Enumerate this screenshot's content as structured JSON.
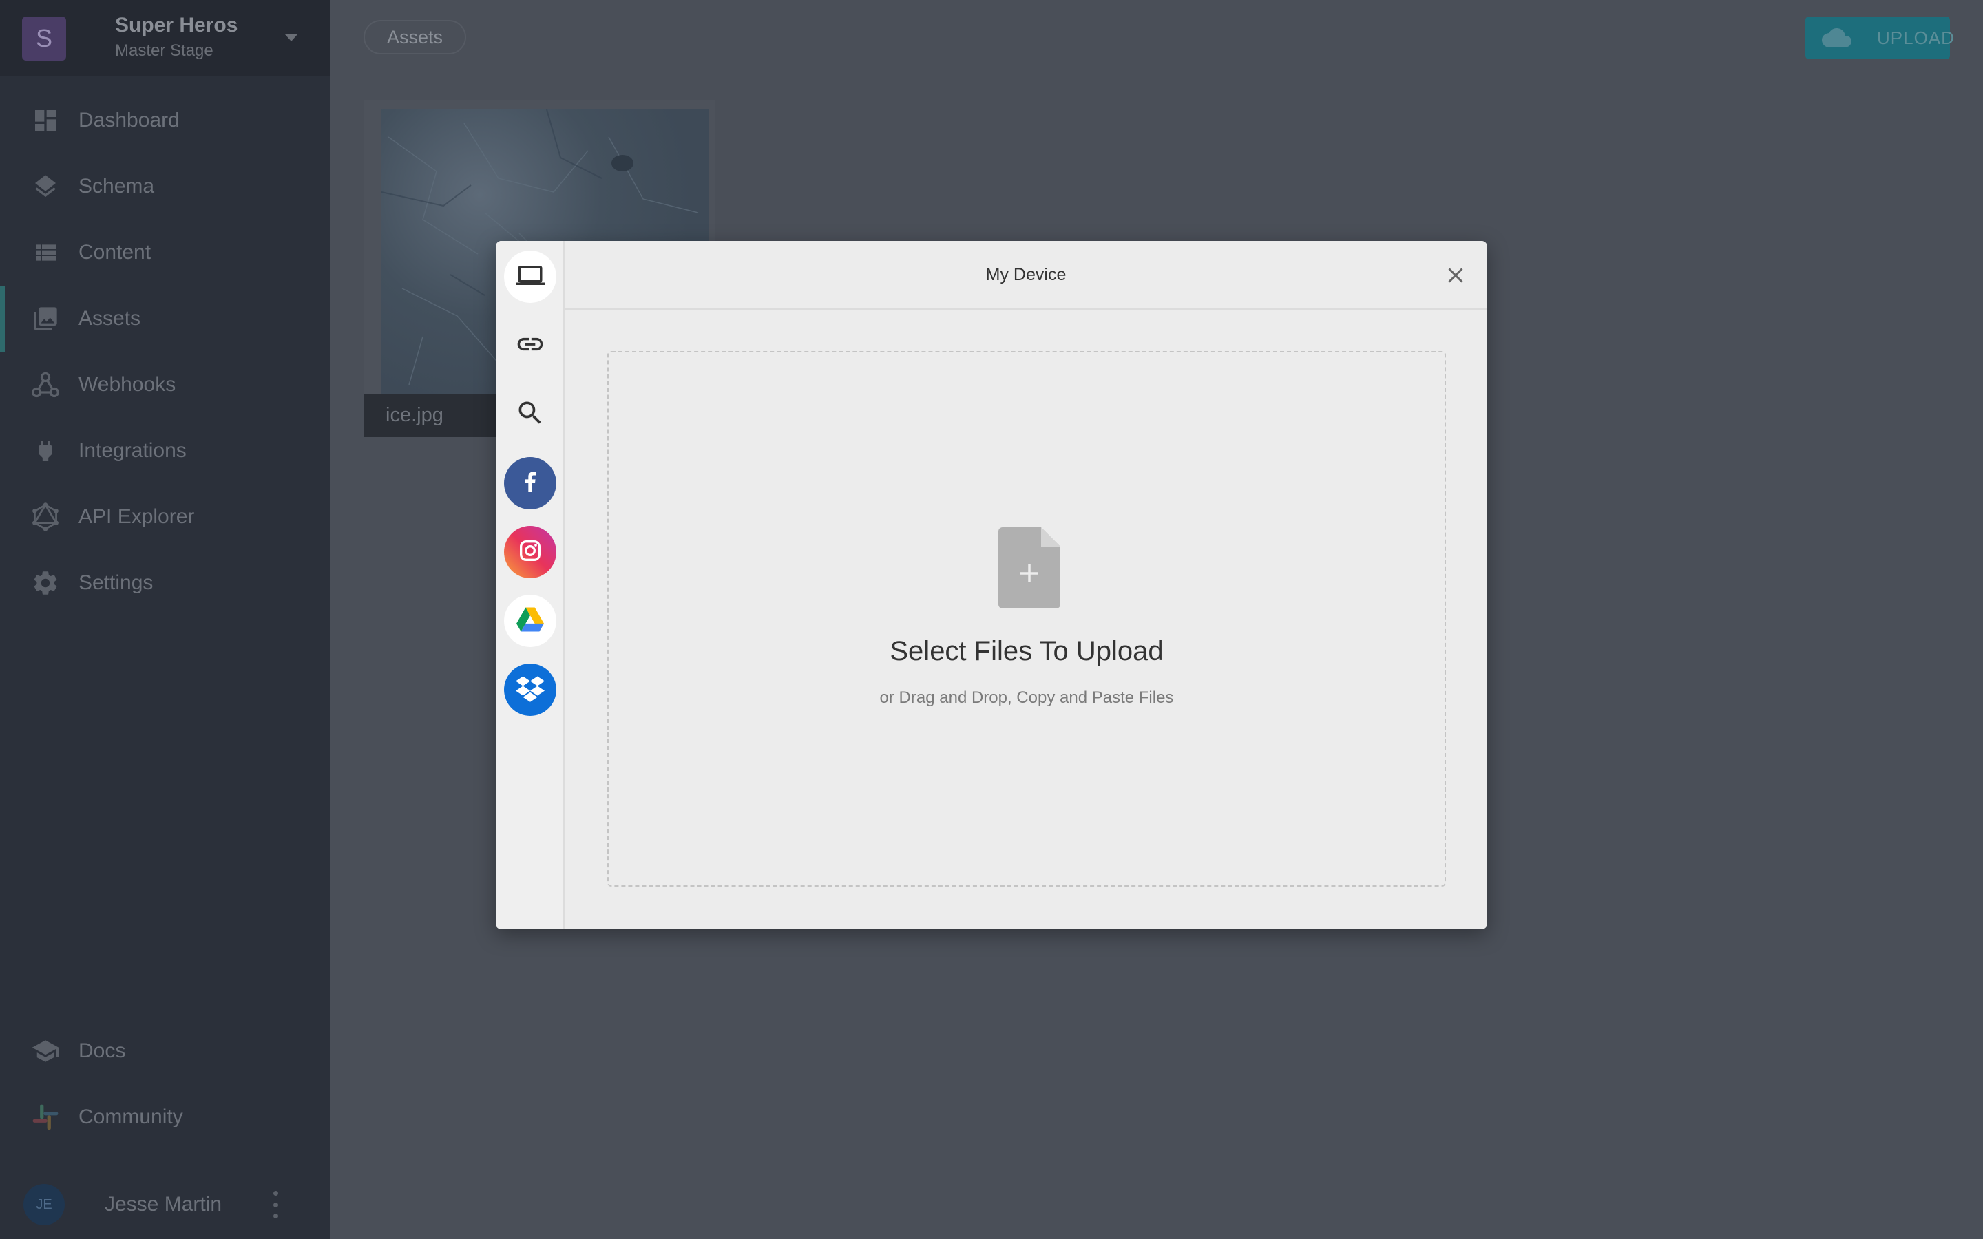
{
  "project": {
    "initial": "S",
    "name": "Super Heros",
    "stage": "Master Stage"
  },
  "nav": {
    "items": [
      {
        "label": "Dashboard",
        "icon": "dashboard-icon"
      },
      {
        "label": "Schema",
        "icon": "layers-icon"
      },
      {
        "label": "Content",
        "icon": "list-icon"
      },
      {
        "label": "Assets",
        "icon": "image-icon",
        "active": true
      },
      {
        "label": "Webhooks",
        "icon": "webhooks-icon"
      },
      {
        "label": "Integrations",
        "icon": "plug-icon"
      },
      {
        "label": "API Explorer",
        "icon": "graphql-icon"
      },
      {
        "label": "Settings",
        "icon": "gear-icon"
      }
    ],
    "bottom": [
      {
        "label": "Docs",
        "icon": "graduation-cap-icon"
      },
      {
        "label": "Community",
        "icon": "slack-icon"
      }
    ]
  },
  "user": {
    "initials": "JE",
    "name": "Jesse Martin"
  },
  "header": {
    "breadcrumb": "Assets",
    "upload_label": "UPLOAD"
  },
  "assets": [
    {
      "name": "ice.jpg"
    }
  ],
  "modal": {
    "title": "My Device",
    "sources": [
      "my-device",
      "link",
      "image-search",
      "facebook",
      "instagram",
      "google-drive",
      "dropbox"
    ],
    "drop_title": "Select Files To Upload",
    "drop_subtitle": "or Drag and Drop, Copy and Paste Files"
  },
  "colors": {
    "sidebar_bg": "#2b303a",
    "main_bg": "#4a4f58",
    "accent": "#1d6e7c",
    "facebook": "#3b5998",
    "dropbox": "#0d6fd8"
  }
}
